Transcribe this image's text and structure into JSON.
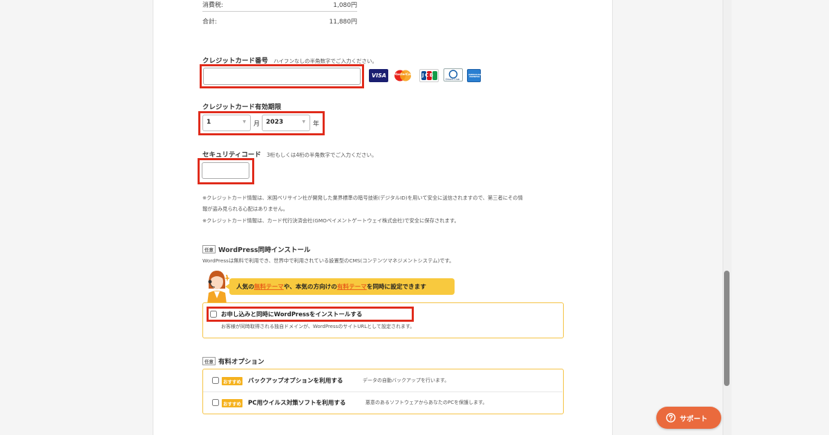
{
  "summary": {
    "tax_label": "消費税:",
    "tax_value": "1,080円",
    "total_label": "合計:",
    "total_value": "11,880円"
  },
  "card_number": {
    "label": "クレジットカード番号",
    "hint": "ハイフンなしの半角数字でご入力ください。",
    "value": "",
    "brands": [
      "VISA",
      "MasterCard",
      "JCB",
      "Diners Club",
      "American Express"
    ],
    "brand_text": {
      "visa": "VISA",
      "mastercard": "MasterCard",
      "jcb": "JCB",
      "diners": "Diners Club",
      "amex": "AMERICAN EXPRESS"
    }
  },
  "expiry": {
    "label": "クレジットカード有効期限",
    "month_value": "1",
    "month_unit": "月",
    "year_value": "2023",
    "year_unit": "年"
  },
  "security": {
    "label": "セキュリティコード",
    "hint": "3桁もしくは4桁の半角数字でご入力ください。",
    "value": ""
  },
  "notes": [
    "※クレジットカード情報は、米国ベリサイン社が開発した業界標準の暗号技術(デジタルID)を用いて安全に送信されますので、第三者にその情",
    "報が盗み見られる心配はありません。",
    "※クレジットカード情報は、カード代行決済会社(GMOペイメントゲートウェイ株式会社)で安全に保存されます。"
  ],
  "wordpress": {
    "badge": "任意",
    "title": "WordPress同時インストール",
    "description": "WordPressは無料で利用でき、世界中で利用されている設置型のCMS(コンテンツマネジメントシステム)です。",
    "banner": {
      "part1": "人気の",
      "highlight1": "無料テーマ",
      "part2": "や、本気の方向けの",
      "highlight2": "有料テーマ",
      "part3": "を同時に設定できます"
    },
    "checkbox_label": "お申し込みと同時にWordPressをインストールする",
    "checkbox_checked": false,
    "sub_note": "お客様が同時取得される独自ドメインが、WordPressのサイトURLとして設定されます。"
  },
  "paid_options": {
    "badge": "任意",
    "title": "有料オプション",
    "items": [
      {
        "badge": "おすすめ",
        "label": "バックアップオプションを利用する",
        "description": "データの自動バックアップを行います。",
        "checked": false
      },
      {
        "badge": "おすすめ",
        "label": "PC用ウイルス対策ソフトを利用する",
        "description": "悪意のあるソフトウェアからあなたのPCを保護します。",
        "checked": false
      }
    ]
  },
  "support": {
    "icon": "question-circle-icon",
    "label": "サポート"
  },
  "colors": {
    "highlight_box": "#e02a1a",
    "accent_yellow": "#f5c242",
    "accent_orange": "#f08a1c",
    "support_button": "#ea6a3d"
  }
}
